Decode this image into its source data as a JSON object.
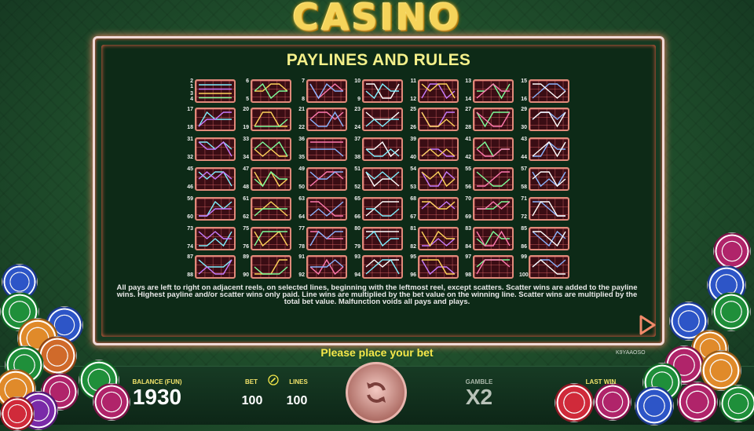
{
  "logo": "CASINO",
  "panel": {
    "title": "PAYLINES AND RULES"
  },
  "paylines": {
    "rows": [
      [
        "2 1 3 4",
        "6 5",
        "7 8",
        "10 9",
        "11 12",
        "13 14",
        "15 16"
      ],
      [
        "17 18",
        "20 19",
        "21 22",
        "23 24",
        "25 26",
        "27 28",
        "29 30"
      ],
      [
        "31 32",
        "33 34",
        "36 35",
        "37 38",
        "39 40",
        "41 42",
        "43 44"
      ],
      [
        "45 46",
        "47 48",
        "49 50",
        "51 52",
        "54 53",
        "55 56",
        "57 58"
      ],
      [
        "59 60",
        "61 62",
        "63 64",
        "65 66",
        "68 67",
        "70 69",
        "71 72"
      ],
      [
        "73 74",
        "75 76",
        "77 78",
        "80 79",
        "81 82",
        "83 84",
        "85 86"
      ],
      [
        "87 88",
        "89 90",
        "91 92",
        "93 94",
        "95 96",
        "97 98",
        "99 100"
      ]
    ]
  },
  "rules_text": "All pays are left to right on adjacent reels, on selected lines, beginning with the leftmost reel, except scatters. Scatter wins are added to the payline wins. Highest payline and/or scatter wins only paid. Line wins are multiplied by the bet value on the winning line. Scatter wins are multiplied by the total bet value. Malfunction voids all pays and plays.",
  "message": "Please place your bet",
  "game_code": "K9YAAOSO",
  "balance": {
    "label": "BALANCE (FUN)",
    "value": "1930"
  },
  "bet": {
    "label": "BET",
    "value": "100"
  },
  "lines": {
    "label": "LINES",
    "value": "100"
  },
  "gamble": {
    "label": "GAMBLE",
    "value": "X2"
  },
  "last_win": {
    "label": "LAST WIN",
    "value": ""
  },
  "icons": {
    "next": "play-arrow-icon",
    "spin": "refresh-icon",
    "edit": "pencil-icon"
  },
  "colors": {
    "accent": "#f5e84a",
    "panel_border": "#f0d9d6",
    "felt": "#1f4d2b"
  }
}
